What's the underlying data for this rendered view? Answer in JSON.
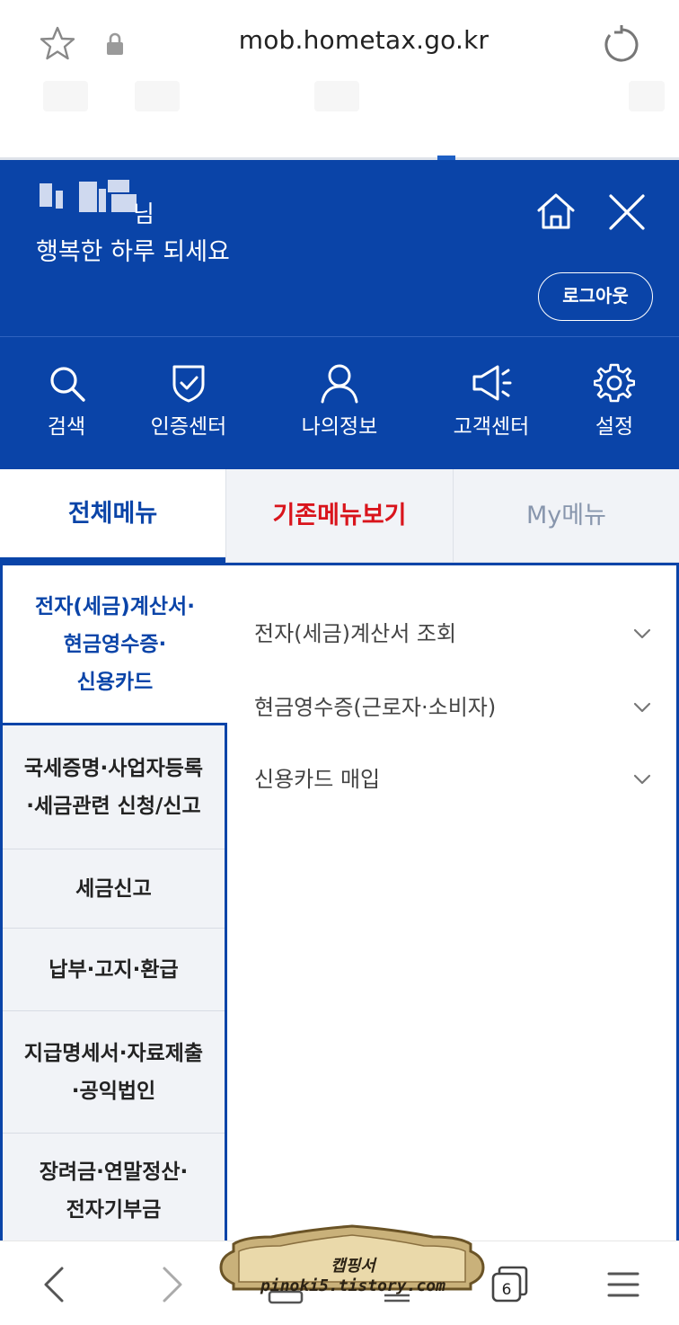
{
  "browser": {
    "url": "mob.hometax.go.kr",
    "tab_count": "6"
  },
  "header": {
    "user_suffix": "님",
    "greeting": "행복한 하루 되세요",
    "logout_label": "로그아웃"
  },
  "quick_menu": [
    {
      "label": "검색",
      "icon": "search-icon"
    },
    {
      "label": "인증센터",
      "icon": "shield-check-icon"
    },
    {
      "label": "나의정보",
      "icon": "user-icon"
    },
    {
      "label": "고객센터",
      "icon": "megaphone-icon"
    },
    {
      "label": "설정",
      "icon": "gear-icon"
    }
  ],
  "tabs": {
    "all": "전체메뉴",
    "old": "기존메뉴보기",
    "my": "My메뉴"
  },
  "categories": [
    {
      "line1": "전자(세금)계산서·",
      "line2": "현금영수증·",
      "line3": "신용카드"
    },
    {
      "line1": "국세증명·사업자등록",
      "line2": "·세금관련 신청/신고"
    },
    {
      "line1": "세금신고"
    },
    {
      "line1": "납부·고지·환급"
    },
    {
      "line1": "지급명세서·자료제출",
      "line2": "·공익법인"
    },
    {
      "line1": "장려금·연말정산·",
      "line2": "전자기부금"
    }
  ],
  "submenu": [
    {
      "label": "전자(세금)계산서 조회"
    },
    {
      "label": "현금영수증(근로자·소비자)"
    },
    {
      "label": "신용카드 매입"
    }
  ],
  "watermark": "캡핑서 pinoki5.tistory.com",
  "colors": {
    "primary": "#0a44a8",
    "accent_red": "#d9141c",
    "muted": "#8896ad",
    "panel_bg": "#f1f3f7"
  }
}
